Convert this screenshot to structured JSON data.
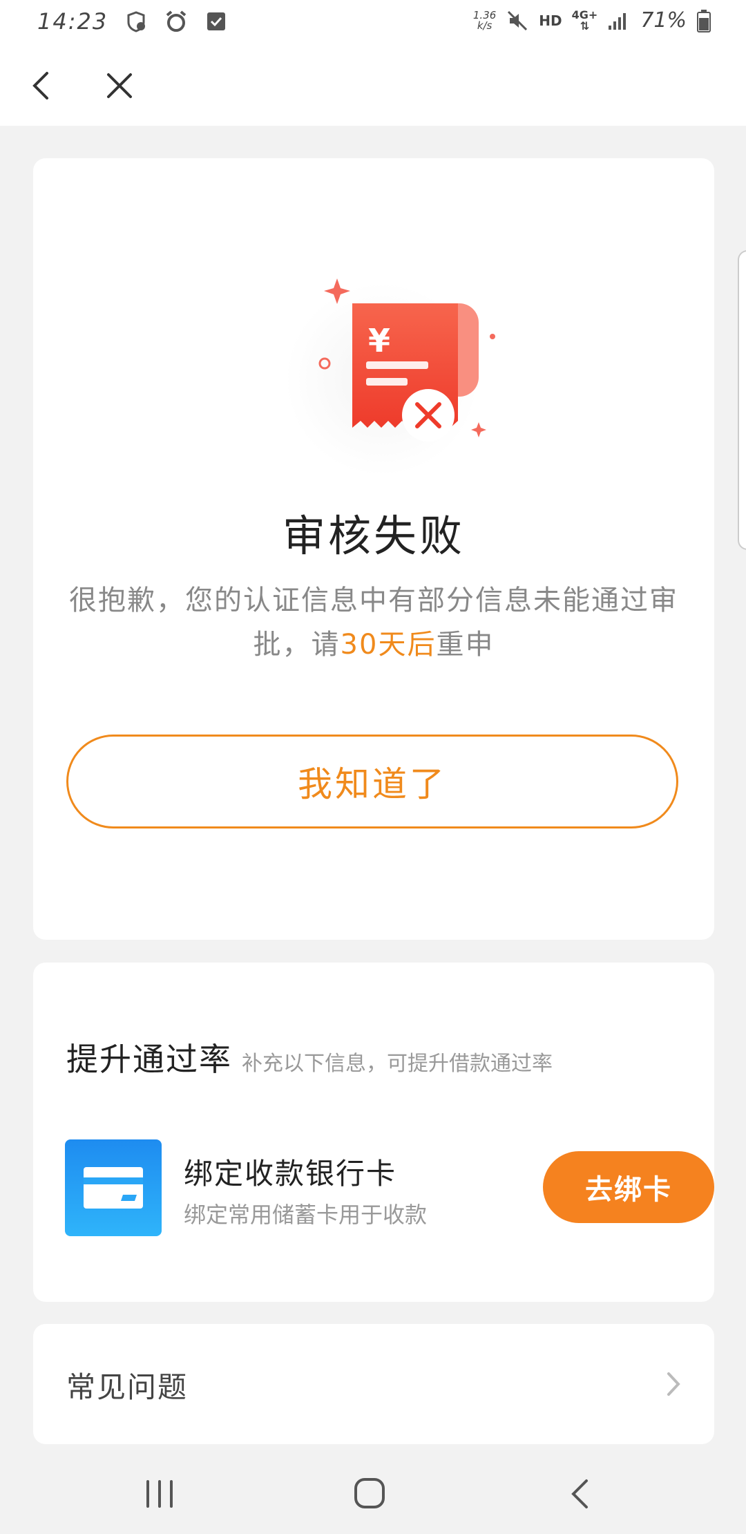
{
  "status_bar": {
    "time": "14:23",
    "speed_value": "1.36",
    "speed_unit": "k/s",
    "hd": "HD",
    "network": "4G+",
    "battery": "71%"
  },
  "result": {
    "title": "审核失败",
    "desc_before": "很抱歉，您的认证信息中有部分信息未能通过审批，请",
    "desc_highlight": "30天后",
    "desc_after": "重申",
    "ack_label": "我知道了"
  },
  "improve": {
    "title": "提升通过率",
    "subtitle": "补充以下信息，可提升借款通过率",
    "bank_title": "绑定收款银行卡",
    "bank_subtitle": "绑定常用储蓄卡用于收款",
    "bind_label": "去绑卡"
  },
  "faq": {
    "label": "常见问题"
  },
  "colors": {
    "accent": "#f08a1c",
    "button_fill": "#f5821f",
    "bank_icon": "#1e8cf0",
    "illustration_red": "#f44b3a"
  },
  "icons": [
    "back-arrow-icon",
    "close-icon",
    "receipt-fail-icon",
    "bank-card-icon",
    "chevron-right-icon"
  ]
}
